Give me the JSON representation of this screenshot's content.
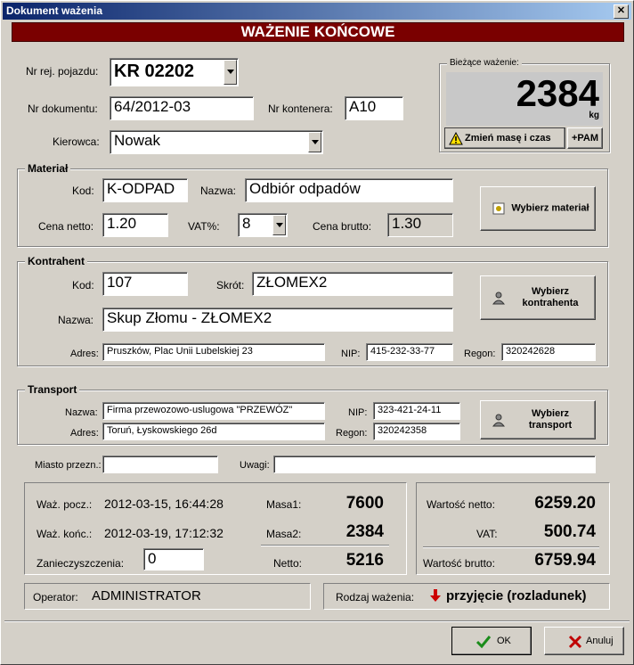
{
  "window": {
    "title": "Dokument ważenia",
    "close": "✕"
  },
  "banner": "WAŻENIE KOŃCOWE",
  "header": {
    "reg_label": "Nr rej. pojazdu:",
    "reg_value": "KR 02202",
    "doc_label": "Nr dokumentu:",
    "doc_value": "64/2012-03",
    "container_label": "Nr kontenera:",
    "container_value": "A10",
    "driver_label": "Kierowca:",
    "driver_value": "Nowak"
  },
  "current": {
    "title": "Bieżące ważenie:",
    "value": "2384",
    "unit": "kg",
    "change_button": "Zmień masę i czas",
    "pam_button": "+PAM"
  },
  "material": {
    "title": "Materiał",
    "code_label": "Kod:",
    "code_value": "K-ODPAD",
    "name_label": "Nazwa:",
    "name_value": "Odbiór odpadów",
    "net_label": "Cena netto:",
    "net_value": "1.20",
    "vat_label": "VAT%:",
    "vat_value": "8",
    "gross_label": "Cena brutto:",
    "gross_value": "1.30",
    "button": "Wybierz materiał"
  },
  "contractor": {
    "title": "Kontrahent",
    "code_label": "Kod:",
    "code_value": "107",
    "short_label": "Skrót:",
    "short_value": "ZŁOMEX2",
    "name_label": "Nazwa:",
    "name_value": "Skup Złomu - ZŁOMEX2",
    "address_label": "Adres:",
    "address_value": "Pruszków, Plac Unii Lubelskiej 23",
    "nip_label": "NIP:",
    "nip_value": "415-232-33-77",
    "regon_label": "Regon:",
    "regon_value": "320242628",
    "button": "Wybierz kontrahenta"
  },
  "transport": {
    "title": "Transport",
    "name_label": "Nazwa:",
    "name_value": "Firma przewozowo-uslugowa \"PRZEWÓZ\"",
    "address_label": "Adres:",
    "address_value": "Toruń, Łyskowskiego 26d",
    "nip_label": "NIP:",
    "nip_value": "323-421-24-11",
    "regon_label": "Regon:",
    "regon_value": "320242358",
    "button": "Wybierz transport"
  },
  "extra": {
    "city_label": "Miasto przezn.:",
    "city_value": "",
    "notes_label": "Uwagi:",
    "notes_value": ""
  },
  "summary": {
    "start_label": "Waż. pocz.:",
    "start_value": "2012-03-15, 16:44:28",
    "end_label": "Waż. końc.:",
    "end_value": "2012-03-19, 17:12:32",
    "contam_label": "Zanieczyszczenia:",
    "contam_value": "0",
    "mass1_label": "Masa1:",
    "mass1_value": "7600",
    "mass2_label": "Masa2:",
    "mass2_value": "2384",
    "net_label": "Netto:",
    "net_value": "5216",
    "value_net_label": "Wartość netto:",
    "value_net": "6259.20",
    "vat_label": "VAT:",
    "vat_value": "500.74",
    "value_gross_label": "Wartość brutto:",
    "value_gross": "6759.94"
  },
  "footer": {
    "operator_label": "Operator:",
    "operator_value": "ADMINISTRATOR",
    "type_label": "Rodzaj ważenia:",
    "type_value": "przyjęcie (rozladunek)",
    "ok": "OK",
    "cancel": "Anuluj"
  },
  "colors": {
    "title_start": "#0a246a",
    "banner": "#7a0000",
    "ok_check": "#1a8c1a",
    "cancel_x": "#c00000",
    "arrow": "#cc0000"
  }
}
